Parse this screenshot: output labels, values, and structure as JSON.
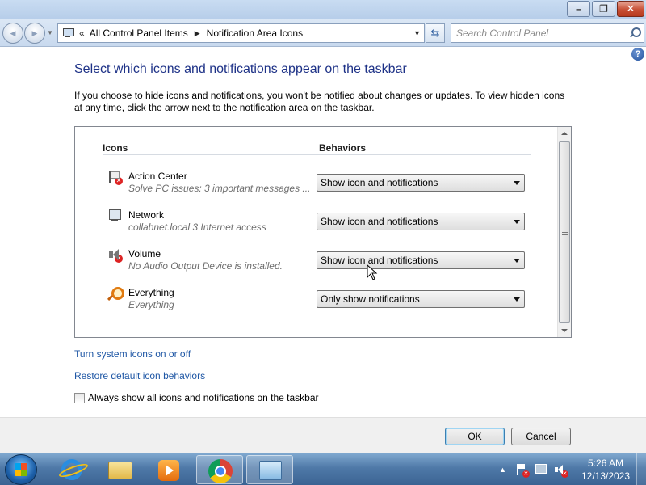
{
  "window": {
    "minimize": "–",
    "maximize": "❐",
    "close": "✕"
  },
  "nav": {
    "back_glyph": "◀",
    "forward_glyph": "▶",
    "address_chevron": "«",
    "breadcrumbs": [
      "All Control Panel Items",
      "Notification Area Icons"
    ],
    "breadcrumb_separator": "▶",
    "search_placeholder": "Search Control Panel",
    "refresh_glyph": "⇆"
  },
  "help_glyph": "?",
  "page": {
    "heading": "Select which icons and notifications appear on the taskbar",
    "description": "If you choose to hide icons and notifications, you won't be notified about changes or updates. To view hidden icons at any time, click the arrow next to the notification area on the taskbar."
  },
  "table": {
    "col_icons": "Icons",
    "col_behaviors": "Behaviors",
    "rows": [
      {
        "name": "Action Center",
        "desc": "Solve PC issues: 3 important messages  ...",
        "behavior": "Show icon and notifications",
        "icon": "action-center-icon"
      },
      {
        "name": "Network",
        "desc": "collabnet.local  3 Internet access",
        "behavior": "Show icon and notifications",
        "icon": "network-icon"
      },
      {
        "name": "Volume",
        "desc": "No Audio Output Device is installed.",
        "behavior": "Show icon and notifications",
        "icon": "volume-icon"
      },
      {
        "name": "Everything",
        "desc": "Everything",
        "behavior": "Only show notifications",
        "icon": "everything-search-icon"
      }
    ]
  },
  "links": {
    "system_icons": "Turn system icons on or off",
    "restore": "Restore default icon behaviors"
  },
  "always_show": {
    "label": "Always show all icons and notifications on the taskbar",
    "checked": false
  },
  "buttons": {
    "ok": "OK",
    "cancel": "Cancel"
  },
  "taskbar": {
    "tray_arrow": "▲",
    "time": "5:26 AM",
    "date": "12/13/2023",
    "badge": "✕"
  }
}
